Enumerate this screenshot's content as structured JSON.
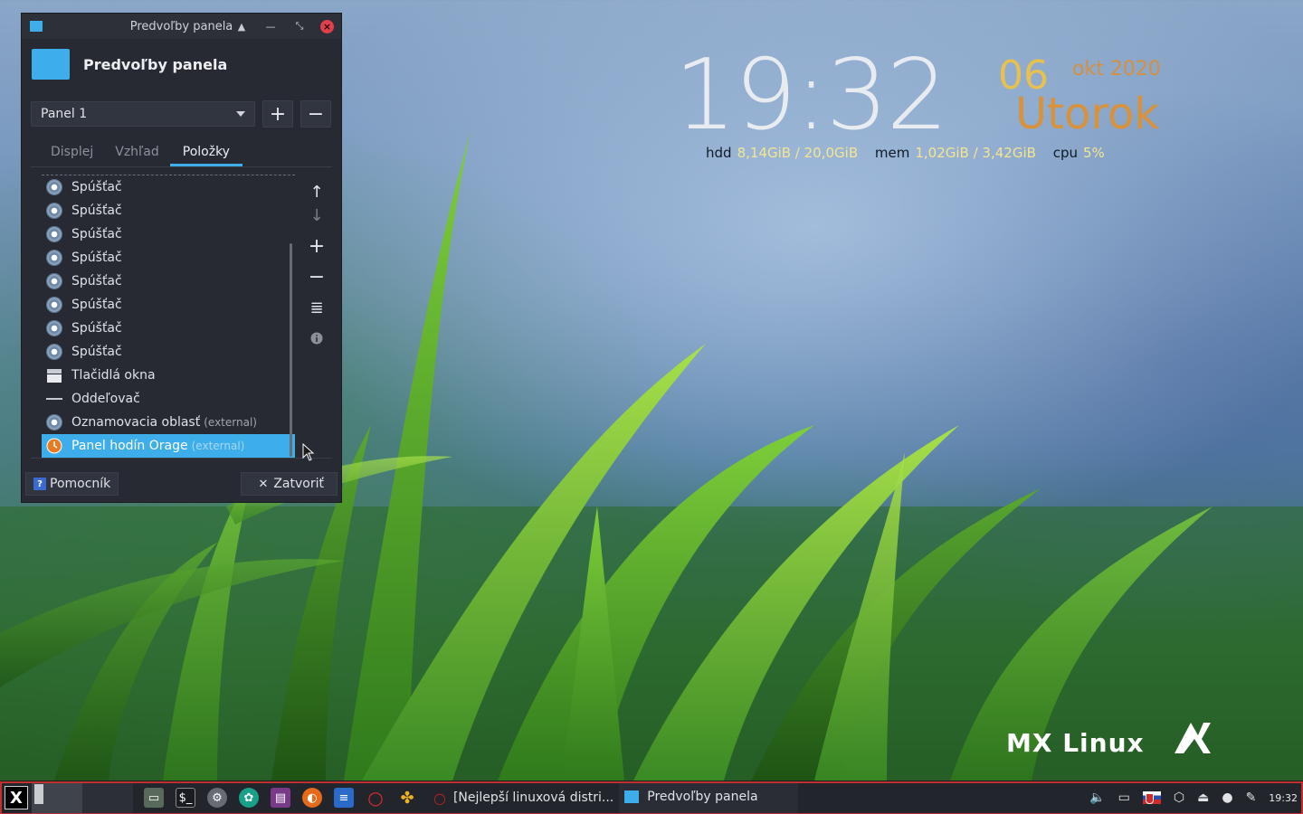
{
  "desktop": {
    "conky": {
      "time": "19:32",
      "day": "06",
      "month_year": "okt 2020",
      "weekday": "Utorok",
      "stats": [
        {
          "label": "hdd",
          "value": "8,14GiB / 20,0GiB"
        },
        {
          "label": "mem",
          "value": "1,02GiB / 3,42GiB"
        },
        {
          "label": "cpu",
          "value": "5%"
        }
      ]
    },
    "brand": "MX Linux"
  },
  "window": {
    "title": "Predvoľby panela",
    "header_title": "Predvoľby panela",
    "panel_select": "Panel 1",
    "tabs": [
      {
        "label": "Displej",
        "active": false
      },
      {
        "label": "Vzhľad",
        "active": false
      },
      {
        "label": "Položky",
        "active": true
      }
    ],
    "items": [
      {
        "label": "Spúšťač",
        "ext": "",
        "icon": "gear-icon"
      },
      {
        "label": "Spúšťač",
        "ext": "",
        "icon": "gear-icon"
      },
      {
        "label": "Spúšťač",
        "ext": "",
        "icon": "gear-icon"
      },
      {
        "label": "Spúšťač",
        "ext": "",
        "icon": "gear-icon"
      },
      {
        "label": "Spúšťač",
        "ext": "",
        "icon": "gear-icon"
      },
      {
        "label": "Spúšťač",
        "ext": "",
        "icon": "gear-icon"
      },
      {
        "label": "Spúšťač",
        "ext": "",
        "icon": "gear-icon"
      },
      {
        "label": "Spúšťač",
        "ext": "",
        "icon": "gear-icon"
      },
      {
        "label": "Tlačidlá okna",
        "ext": "",
        "icon": "window-buttons-icon"
      },
      {
        "label": "Oddeľovač",
        "ext": "",
        "icon": "separator-icon"
      },
      {
        "label": "Oznamovacia oblasť",
        "ext": "(external)",
        "icon": "gear-icon"
      },
      {
        "label": "Panel hodín Orage",
        "ext": "(external)",
        "icon": "clock-icon",
        "selected": true
      }
    ],
    "help_label": "Pomocník",
    "close_label": "Zatvoriť"
  },
  "taskbar": {
    "tasks": [
      {
        "label": "[Nejlepší linuxová distri...",
        "active": false
      },
      {
        "label": "Predvoľby panela",
        "active": true
      }
    ],
    "clock": "19:32"
  },
  "colors": {
    "accent": "#3daee9",
    "window_bg": "#272a33",
    "conky_day": "#e8c050",
    "conky_weekday": "#d8923c",
    "conky_value": "#f4e690"
  }
}
